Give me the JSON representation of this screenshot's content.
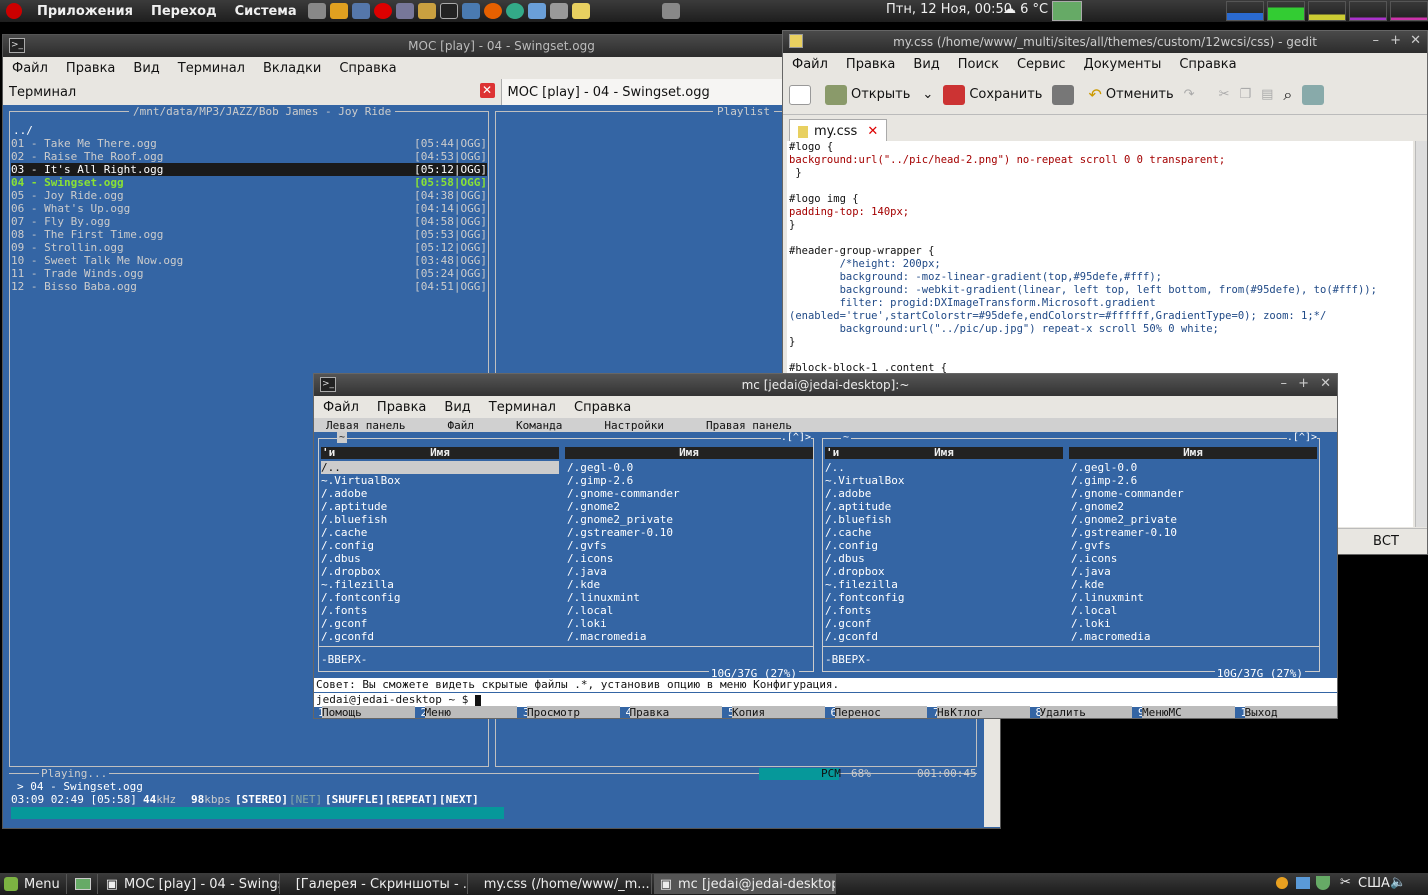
{
  "top_panel": {
    "menus": [
      "Приложения",
      "Переход",
      "Система"
    ],
    "clock": "Птн, 12 Ноя, 00:50",
    "weather": "6 °C"
  },
  "moc": {
    "title": "MOC [play] - 04 - Swingset.ogg",
    "menu": [
      "Файл",
      "Правка",
      "Вид",
      "Терминал",
      "Вкладки",
      "Справка"
    ],
    "tabs": [
      "Терминал",
      "MOC [play] - 04 - Swingset.ogg"
    ],
    "path": "/mnt/data/MP3/JAZZ/Bob James - Joy Ride",
    "playlist_label": "Playlist",
    "up_dir": "../",
    "tracks": [
      {
        "name": "01 - Take Me There.ogg",
        "time": "[05:44|OGG]"
      },
      {
        "name": "02 - Raise The Roof.ogg",
        "time": "[04:53|OGG]"
      },
      {
        "name": "03 - It's All Right.ogg",
        "time": "[05:12|OGG]"
      },
      {
        "name": "04 - Swingset.ogg",
        "time": "[05:58|OGG]"
      },
      {
        "name": "05 - Joy Ride.ogg",
        "time": "[04:38|OGG]"
      },
      {
        "name": "06 - What's Up.ogg",
        "time": "[04:14|OGG]"
      },
      {
        "name": "07 - Fly By.ogg",
        "time": "[04:58|OGG]"
      },
      {
        "name": "08 - The First Time.ogg",
        "time": "[05:53|OGG]"
      },
      {
        "name": "09 - Strollin.ogg",
        "time": "[05:12|OGG]"
      },
      {
        "name": "10 - Sweet Talk Me Now.ogg",
        "time": "[03:48|OGG]"
      },
      {
        "name": "11 - Trade Winds.ogg",
        "time": "[05:24|OGG]"
      },
      {
        "name": "12 - Bisso Baba.ogg",
        "time": "[04:51|OGG]"
      }
    ],
    "status": "Playing...",
    "pcm": "PCM",
    "volume": "68%",
    "elapsed": "001:00:45",
    "now_playing": "> 04 - Swingset.ogg",
    "info": "03:09 02:49 [05:58]",
    "khz": "44",
    "khz_unit": "kHz",
    "kbps": "98",
    "kbps_unit": "kbps",
    "flags": [
      "[STEREO]",
      "[NET]",
      "[SHUFFLE]",
      "[REPEAT]",
      "[NEXT]"
    ],
    "progress": 0.51
  },
  "gedit": {
    "title": "my.css (/home/www/_multi/sites/all/themes/custom/12wcsi/css) - gedit",
    "menu": [
      "Файл",
      "Правка",
      "Вид",
      "Поиск",
      "Сервис",
      "Документы",
      "Справка"
    ],
    "toolbar": {
      "open": "Открыть",
      "save": "Сохранить",
      "undo": "Отменить"
    },
    "tab": "my.css",
    "status_mode": "ВСТ",
    "code": [
      "#logo {",
      "background:url(\"../pic/head-2.png\") no-repeat scroll 0 0 transparent;",
      " }",
      "",
      "#logo img {",
      "padding-top: 140px;",
      "}",
      "",
      "#header-group-wrapper {",
      "        /*height: 200px;",
      "        background: -moz-linear-gradient(top,#95defe,#fff);",
      "        background: -webkit-gradient(linear, left top, left bottom, from(#95defe), to(#fff));",
      "        filter: progid:DXImageTransform.Microsoft.gradient",
      "(enabled='true',startColorstr=#95defe,endColorstr=#ffffff,GradientType=0); zoom: 1;*/",
      "        background:url(\"../pic/up.jpg\") repeat-x scroll 50% 0 white;",
      "}",
      "",
      "#block-block-1 .content {"
    ]
  },
  "mc": {
    "title": "mc [jedai@jedai-desktop]:~",
    "menu": [
      "Файл",
      "Правка",
      "Вид",
      "Терминал",
      "Справка"
    ],
    "mc_menu": [
      "Левая панель",
      "Файл",
      "Команда",
      "Настройки",
      "Правая панель"
    ],
    "panel_path": "~",
    "panel_corner": ".[^]>",
    "col_header_left": "'и",
    "col_header_name": "Имя",
    "list_left": [
      "/..",
      "~.VirtualBox",
      "/.adobe",
      "/.aptitude",
      "/.bluefish",
      "/.cache",
      "/.config",
      "/.dbus",
      "/.dropbox",
      "~.filezilla",
      "/.fontconfig",
      "/.fonts",
      "/.gconf",
      "/.gconfd"
    ],
    "list_right": [
      "/.gegl-0.0",
      "/.gimp-2.6",
      "/.gnome-commander",
      "/.gnome2",
      "/.gnome2_private",
      "/.gstreamer-0.10",
      "/.gvfs",
      "/.icons",
      "/.java",
      "/.kde",
      "/.linuxmint",
      "/.local",
      "/.loki",
      "/.macromedia"
    ],
    "updir": "-ВВЕРХ-",
    "disk": "10G/37G (27%)",
    "hint": "Совет: Вы сможете видеть скрытые файлы .*, установив опцию в меню Конфигурация.",
    "prompt": "jedai@jedai-desktop ~ $",
    "fkeys": [
      {
        "n": "1",
        "l": "Помощь"
      },
      {
        "n": "2",
        "l": "Меню"
      },
      {
        "n": "3",
        "l": "Просмотр"
      },
      {
        "n": "4",
        "l": "Правка"
      },
      {
        "n": "5",
        "l": "Копия"
      },
      {
        "n": "6",
        "l": "Перенос"
      },
      {
        "n": "7",
        "l": "НвКтлог"
      },
      {
        "n": "8",
        "l": "Удалить"
      },
      {
        "n": "9",
        "l": "МенюМС"
      },
      {
        "n": "10",
        "l": "Выход"
      }
    ]
  },
  "taskbar": {
    "menu": "Menu",
    "tasks": [
      "MOC [play] - 04 - Swings...",
      "[Галерея - Скриншоты - ...",
      "my.css (/home/www/_m...",
      "mc [jedai@jedai-desktop]:~"
    ],
    "locale": "США"
  }
}
